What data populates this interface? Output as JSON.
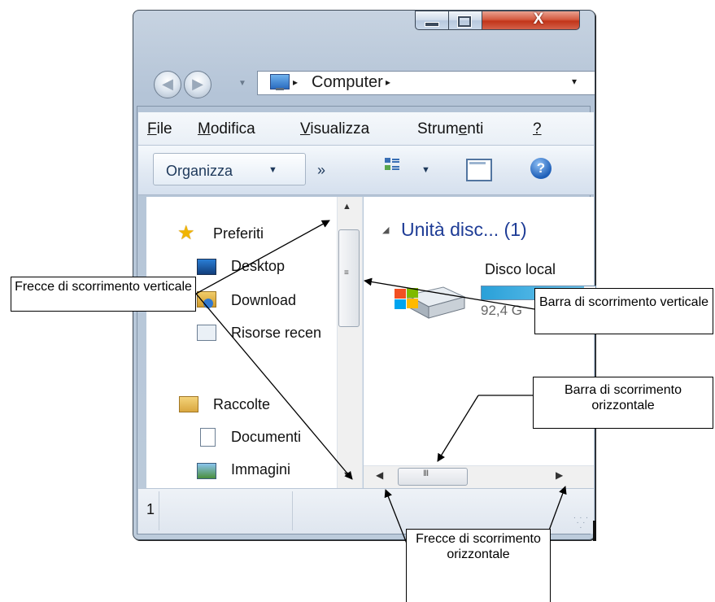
{
  "window": {
    "minimize_icon": "minimize-icon",
    "maximize_icon": "maximize-icon",
    "close_glyph": "X"
  },
  "navigation": {
    "back_icon": "back-arrow-icon",
    "forward_icon": "forward-arrow-icon",
    "address": {
      "location_icon": "computer-icon",
      "separator": "▸",
      "text": "Computer",
      "dropdown": "▾"
    }
  },
  "menubar": {
    "items": [
      {
        "accel": "F",
        "rest": "ile"
      },
      {
        "accel": "M",
        "rest": "odifica"
      },
      {
        "accel": "V",
        "rest": "isualizza"
      },
      {
        "pre": "Strum",
        "accel": "e",
        "rest": "nti"
      },
      {
        "accel": "?",
        "rest": ""
      }
    ]
  },
  "toolbar": {
    "organize_label": "Organizza",
    "organize_caret": "▼",
    "more_label": "»",
    "view_caret": "▼",
    "help_glyph": "?"
  },
  "nav_pane": {
    "favorites": {
      "label": "Preferiti",
      "items": [
        "Desktop",
        "Download",
        "Risorse recen"
      ]
    },
    "libraries": {
      "label": "Raccolte",
      "items": [
        "Documenti",
        "Immagini"
      ]
    }
  },
  "content": {
    "group_header": "Unità disc... (1)",
    "drive": {
      "name": "Disco local",
      "usage_fraction": 0.9,
      "size_text": "92,4 G"
    }
  },
  "scrollbars": {
    "vertical": {
      "up": "▲",
      "down": "▼",
      "grip": "≡"
    },
    "horizontal": {
      "left": "◀",
      "right": "▶",
      "grip": "III"
    }
  },
  "statusbar": {
    "text": "1"
  },
  "callouts": {
    "vertical_arrows": "Frecce di scorrimento verticale",
    "vertical_bar": "Barra di scorrimento verticale",
    "horizontal_bar": "Barra di scorrimento orizzontale",
    "horizontal_arrows": "Frecce di scorrimento orizzontale"
  }
}
